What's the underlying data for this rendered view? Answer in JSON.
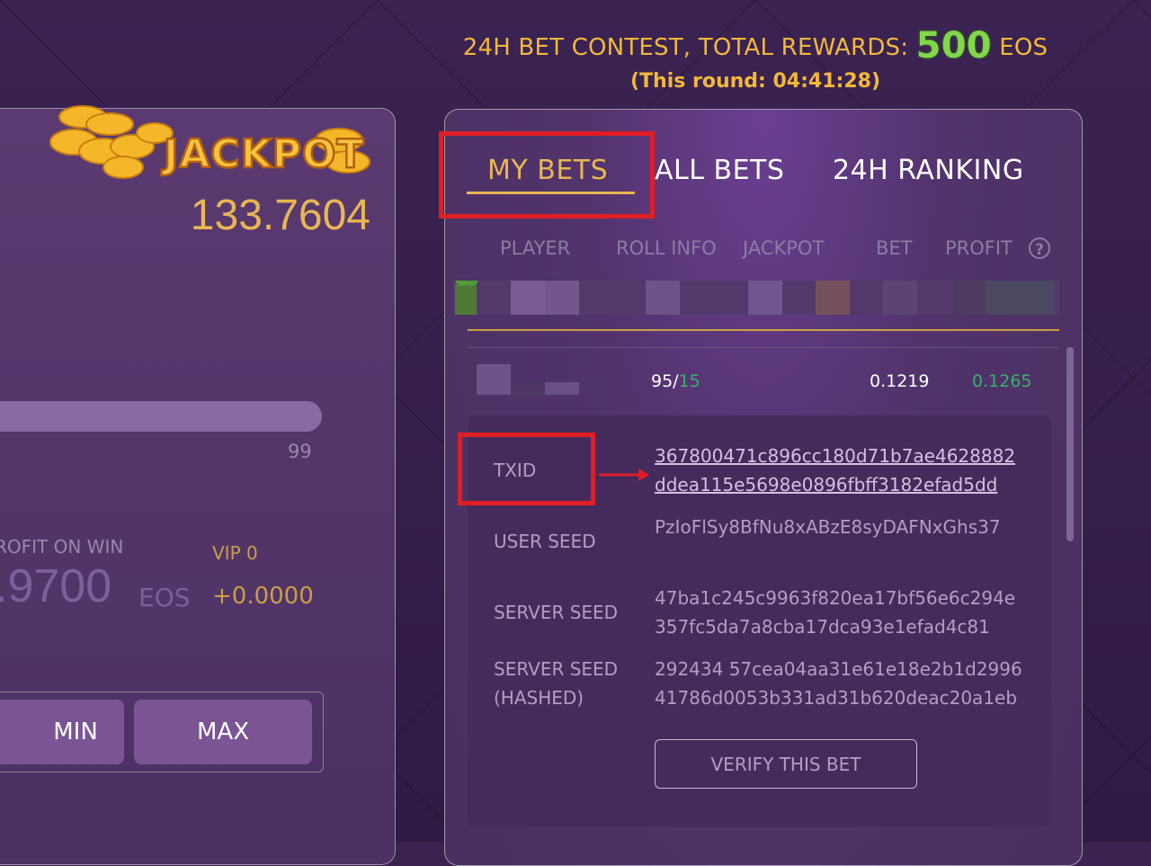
{
  "banner": {
    "contest_prefix": "24H BET CONTEST, TOTAL REWARDS: ",
    "contest_amount": "500",
    "contest_unit": " EOS",
    "round": "(This round: 04:41:28)"
  },
  "left": {
    "jackpot_logo_text": "JACKPOT",
    "jackpot_value": "133.7604",
    "slider_max": "99",
    "profit_label": "ROFIT ON WIN",
    "profit_value": ".9700",
    "profit_unit": "EOS",
    "vip_label": "VIP 0",
    "vip_value": "+0.0000",
    "min_label": "MIN",
    "max_label": "MAX"
  },
  "tabs": [
    {
      "label": "MY BETS",
      "active": true
    },
    {
      "label": "ALL BETS",
      "active": false
    },
    {
      "label": "24H RANKING",
      "active": false
    }
  ],
  "table": {
    "headers": [
      "PLAYER",
      "ROLL INFO",
      "JACKPOT",
      "BET",
      "PROFIT"
    ],
    "help_icon": "?",
    "row": {
      "roll_value": "95/",
      "roll_target": "15",
      "bet": "0.1219",
      "profit": "0.1265"
    }
  },
  "details": {
    "txid_label": "TXID",
    "txid_value": "367800471c896cc180d71b7ae4628882ddea115e5698e0896fbff3182efad5dd",
    "user_seed_label": "USER SEED",
    "user_seed_value": "PzIoFlSy8BfNu8xABzE8syDAFNxGhs37",
    "server_seed_label": "SERVER SEED",
    "server_seed_value": "47ba1c245c9963f820ea17bf56e6c294e357fc5da7a8cba17dca93e1efad4c81",
    "server_seed_hashed_label_1": "SERVER SEED",
    "server_seed_hashed_label_2": "(HASHED)",
    "server_seed_hashed_value": "292434 57cea04aa31e61e18e2b1d299641786d0053b331ad31b620deac20a1eb",
    "verify_label": "VERIFY THIS BET"
  },
  "colors": {
    "gold": "#e8b653",
    "green": "#35b36a",
    "highlight_red": "#e01e26"
  }
}
